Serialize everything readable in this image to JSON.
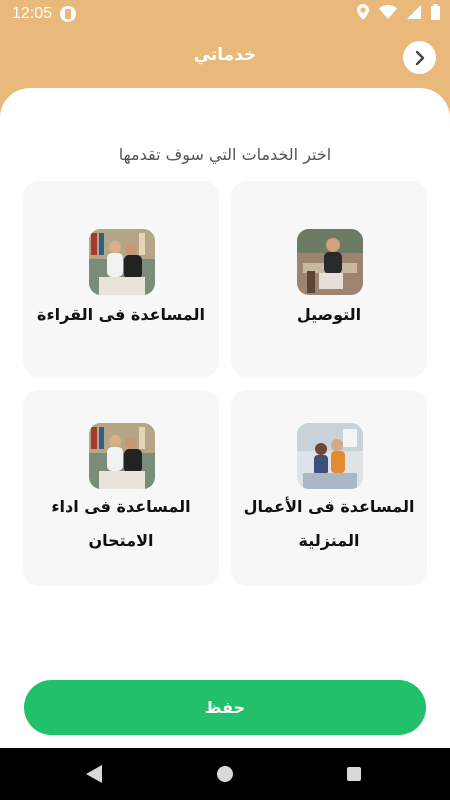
{
  "status_bar": {
    "time": "12:05"
  },
  "header": {
    "title": "خدماتي"
  },
  "subtitle": "اختر الخدمات التي سوف تقدمها",
  "services": [
    {
      "label": "التوصيل",
      "image": "photo-delivery"
    },
    {
      "label": "المساعدة فى القراءة",
      "image": "photo-reading-help"
    },
    {
      "label": "المساعدة فى الأعمال المنزلية",
      "image": "photo-housework-help"
    },
    {
      "label": "المساعدة فى اداء الامتحان",
      "image": "photo-exam-help"
    }
  ],
  "save_button": {
    "label": "حفظ"
  },
  "colors": {
    "header_bg": "#E8B97A",
    "accent_green": "#22C06A",
    "card_bg": "#F7F7F7"
  }
}
